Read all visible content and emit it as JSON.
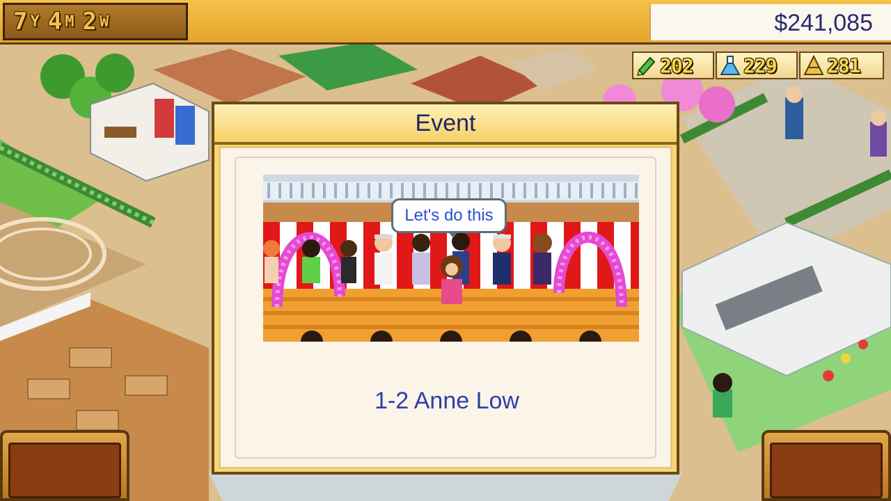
{
  "date": {
    "years": "7",
    "years_unit": "Y",
    "months": "4",
    "months_unit": "M",
    "weeks": "2",
    "weeks_unit": "W"
  },
  "money": "$241,085",
  "stats": [
    {
      "icon": "pencil-icon",
      "value": "202"
    },
    {
      "icon": "flask-icon",
      "value": "229"
    },
    {
      "icon": "pyramid-icon",
      "value": "281"
    }
  ],
  "event": {
    "title": "Event",
    "speech": "Let's do this",
    "student": "1-2 Anne Low"
  },
  "colors": {
    "title_text": "#1f2660",
    "student_text": "#2c3fa8",
    "speech_text": "#2b4fd0",
    "money_text": "#2d2a6e"
  }
}
